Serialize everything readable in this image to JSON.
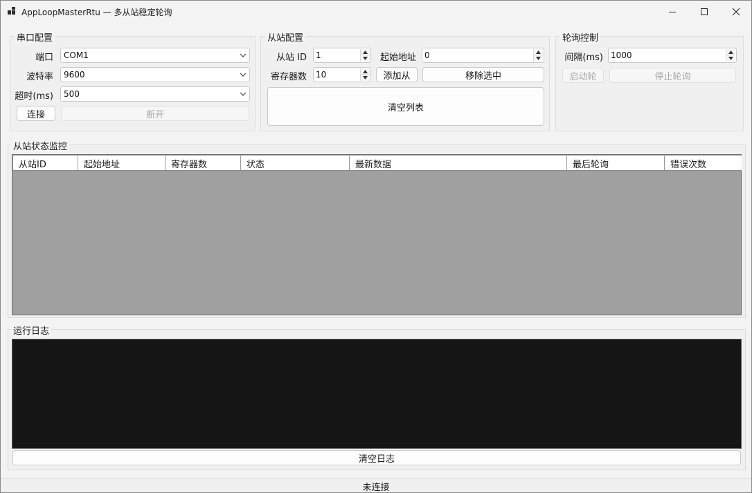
{
  "window": {
    "title": "AppLoopMasterRtu — 多从站稳定轮询"
  },
  "serial": {
    "group_title": "串口配置",
    "port_label": "端口",
    "port_value": "COM1",
    "baud_label": "波特率",
    "baud_value": "9600",
    "timeout_label": "超时(ms)",
    "timeout_value": "500",
    "connect_label": "连接",
    "disconnect_label": "断开"
  },
  "slave": {
    "group_title": "从站配置",
    "id_label": "从站 ID",
    "id_value": "1",
    "start_label": "起始地址",
    "start_value": "0",
    "count_label": "寄存器数",
    "count_value": "10",
    "add_label": "添加从",
    "remove_label": "移除选中",
    "clear_label": "清空列表"
  },
  "poll": {
    "group_title": "轮询控制",
    "interval_label": "间隔(ms)",
    "interval_value": "1000",
    "start_label": "启动轮",
    "stop_label": "停止轮询"
  },
  "monitor": {
    "group_title": "从站状态监控",
    "columns": [
      "从站ID",
      "起始地址",
      "寄存器数",
      "状态",
      "最新数据",
      "最后轮询",
      "错误次数"
    ]
  },
  "log": {
    "group_title": "运行日志",
    "clear_label": "清空日志"
  },
  "status": {
    "text": "未连接"
  }
}
